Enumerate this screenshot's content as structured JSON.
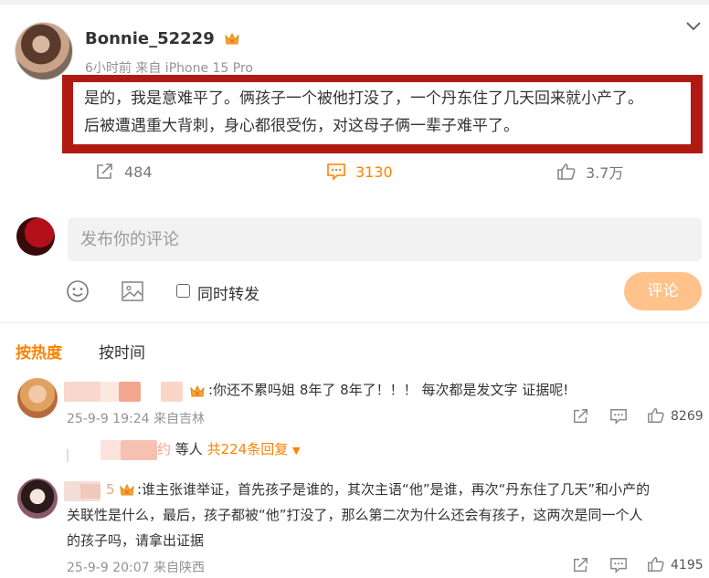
{
  "post": {
    "username": "Bonnie_52229",
    "meta": "6小时前 来自 iPhone 15 Pro",
    "text_lines": [
      "是的，我是意难平了。俩孩子一个被他打没了，一个丹东住了几天回来就小产了。",
      "后被遭遇重大背刺，身心都很受伤，对这母子俩一辈子难平了。"
    ],
    "actions": {
      "share_count": "484",
      "comment_count": "3130",
      "like_count": "3.7万"
    }
  },
  "composer": {
    "placeholder": "发布你的评论",
    "forward_label": "同时转发",
    "submit_label": "评论"
  },
  "sort": {
    "hot": "按热度",
    "time": "按时间"
  },
  "comments": [
    {
      "text": ":你还不累吗姐 8年了 8年了！！！ 每次都是发文字 证据呢!",
      "meta": "25-9-9 19:24 来自吉林",
      "likes": "8269",
      "replies": {
        "name_suffix": "约",
        "people_label": "等人",
        "more_label": "共224条回复"
      }
    },
    {
      "name_suffix": "5",
      "text_lines": [
        ":谁主张谁举证，首先孩子是谁的，其次主语“他”是谁，再次“丹东住了几天”和小产的",
        "关联性是什么，最后，孩子都被“他”打没了，那么第二次为什么还会有孩子，这两次是同一个人",
        "的孩子吗，请拿出证据"
      ],
      "meta": "25-9-9 20:07 来自陕西",
      "likes": "4195"
    }
  ],
  "colors": {
    "accent": "#ff8200",
    "highlight_border": "#b11a12",
    "submit_disabled": "#ffc28a"
  }
}
